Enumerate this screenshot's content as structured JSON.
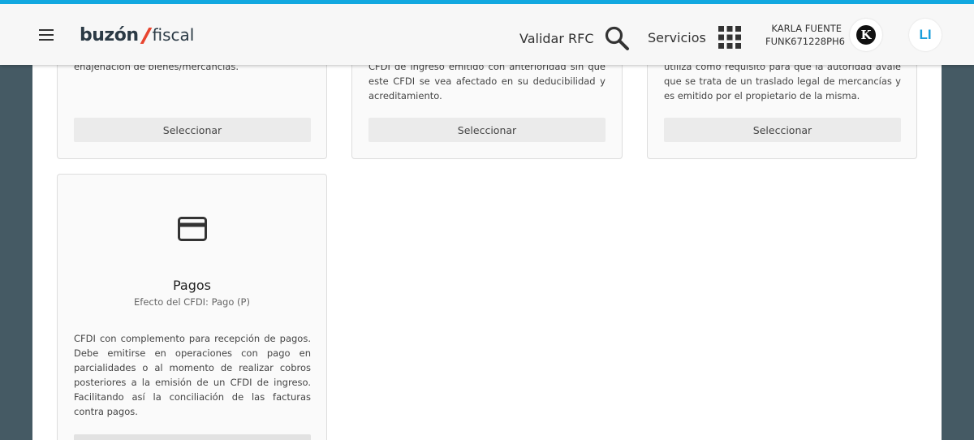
{
  "header": {
    "brand_main": "buzón",
    "brand_sub": "fiscal",
    "validar_label": "Validar RFC",
    "servicios_label": "Servicios",
    "user_name": "KARLA FUENTE",
    "user_rfc": "FUNK671228PH6",
    "user_logo_letter": "K",
    "avatar_initials": "LI",
    "accent_color": "#12a8e0"
  },
  "cards_top": [
    {
      "description": "enajenación de bienes/mercancías.",
      "button_label": "Seleccionar"
    },
    {
      "description": "CFDI de ingreso emitido con anterioridad sin que este CFDI se vea afectado en su deducibilidad y acreditamiento.",
      "button_label": "Seleccionar"
    },
    {
      "description": "utiliza como requisito para que la autoridad avale que se trata de un traslado legal de mercancías y es emitido por el propietario de la misma.",
      "button_label": "Seleccionar"
    }
  ],
  "pagos_card": {
    "icon": "credit-card-icon",
    "title": "Pagos",
    "subtitle": "Efecto del CFDI: Pago (P)",
    "description": "CFDI con complemento para recepción de pagos. Debe emitirse en operaciones con pago en parcialidades o al momento de realizar cobros posteriores a la emisión de un CFDI de ingreso. Facilitando así la conciliación de las facturas contra pagos."
  }
}
